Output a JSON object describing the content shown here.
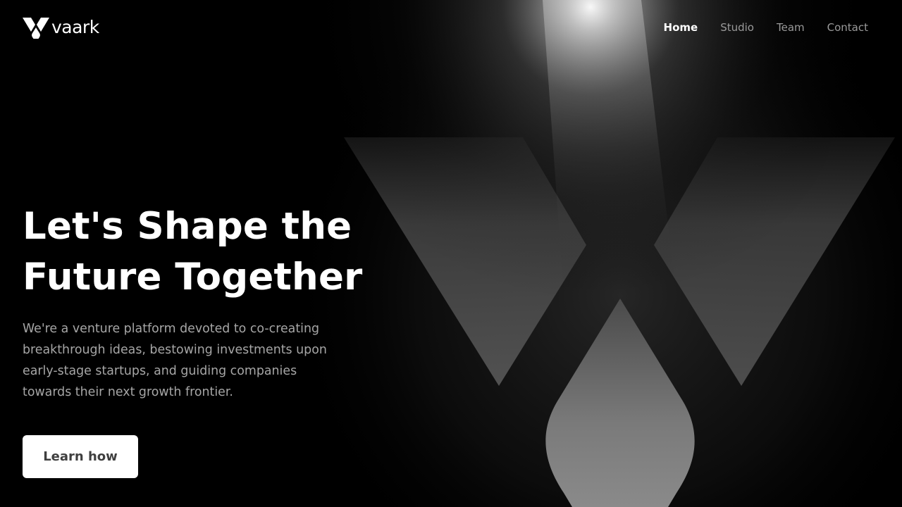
{
  "brand": {
    "name": "vaark",
    "logo_icon": "vaark-v-logo-icon"
  },
  "nav": {
    "items": [
      {
        "label": "Home",
        "active": true
      },
      {
        "label": "Studio",
        "active": false
      },
      {
        "label": "Team",
        "active": false
      },
      {
        "label": "Contact",
        "active": false
      }
    ]
  },
  "hero": {
    "headline_lines": [
      "Let's Shape the",
      "Future Together"
    ],
    "description_lines": [
      "We're a venture platform devoted to co-creating",
      "breakthrough ideas, bestowing investments upon",
      "early-stage startups, and guiding companies",
      "towards their next growth frontier."
    ],
    "cta_label": "Learn how"
  },
  "colors": {
    "background": "#000000",
    "text_primary": "#ffffff",
    "text_muted": "#a6a6a6",
    "nav_inactive": "#9a9a9a",
    "cta_background": "#ffffff",
    "cta_text": "#3f3f3f"
  }
}
